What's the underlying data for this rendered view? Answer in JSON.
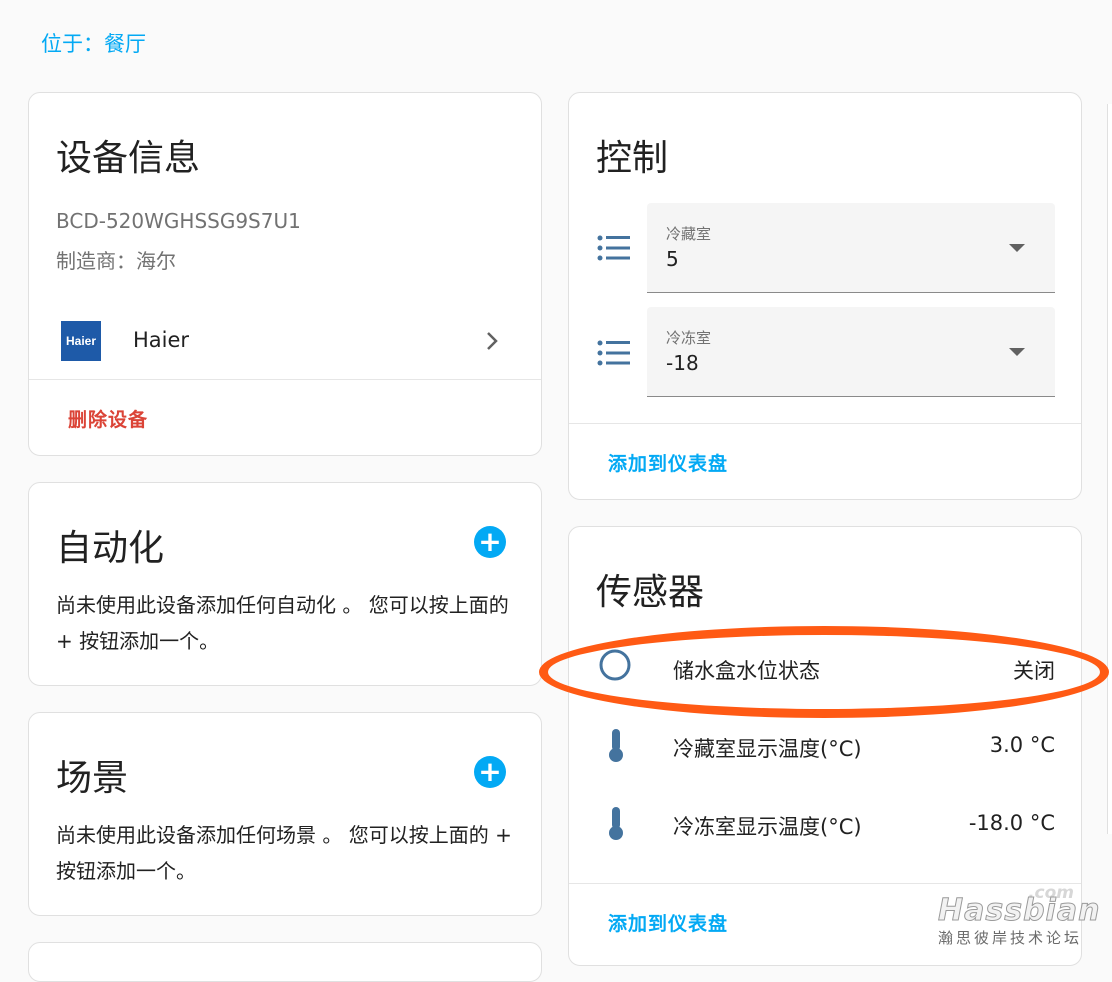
{
  "area": {
    "label": "位于：餐厅"
  },
  "device_info": {
    "title": "设备信息",
    "model": "BCD-520WGHSSG9S7U1",
    "manufacturer": "制造商：海尔",
    "integration": {
      "logo_text": "Haier",
      "name": "Haier"
    },
    "delete_label": "删除设备"
  },
  "automation": {
    "title": "自动化",
    "body": "尚未使用此设备添加任何自动化 。 您可以按上面的 + 按钮添加一个。",
    "add_label": "+"
  },
  "scene": {
    "title": "场景",
    "body": "尚未使用此设备添加任何场景 。 您可以按上面的 + 按钮添加一个。",
    "add_label": "+"
  },
  "controls": {
    "title": "控制",
    "selects": [
      {
        "label": "冷藏室",
        "value": "5"
      },
      {
        "label": "冷冻室",
        "value": "-18"
      }
    ],
    "add_to_dashboard": "添加到仪表盘"
  },
  "sensors": {
    "title": "传感器",
    "rows": [
      {
        "name": "储水盒水位状态",
        "state": "关闭",
        "icon": "circle-outline-icon"
      },
      {
        "name": "冷藏室显示温度(°C)",
        "state": "3.0 °C",
        "icon": "thermometer-icon"
      },
      {
        "name": "冷冻室显示温度(°C)",
        "state": "-18.0 °C",
        "icon": "thermometer-icon"
      }
    ],
    "add_to_dashboard": "添加到仪表盘"
  },
  "watermark": {
    "com": ".com",
    "brand": "Hassbian",
    "tagline": "瀚思彼岸技术论坛"
  },
  "colors": {
    "accent": "#03a9f4",
    "danger": "#db4437",
    "icon": "#44739e",
    "annotation": "#ff5a14"
  }
}
